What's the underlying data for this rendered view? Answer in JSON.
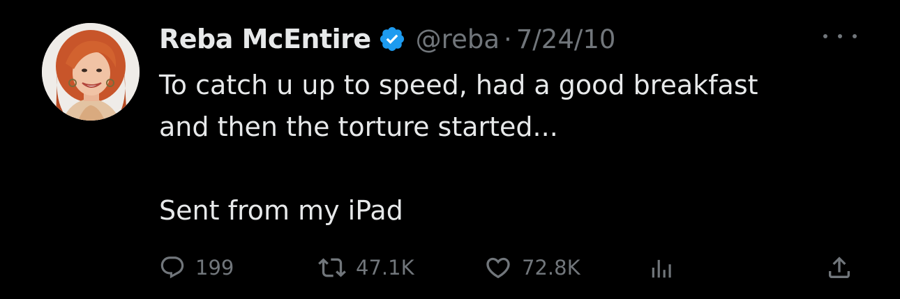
{
  "tweet": {
    "display_name": "Reba McEntire",
    "handle": "@reba",
    "separator": "·",
    "date": "7/24/10",
    "text_line1": "To catch u up to speed, had a good breakfast",
    "text_line2": "and then the torture started...",
    "text_line3": "Sent from my iPad",
    "verified_color": "#1d9bf0"
  },
  "actions": {
    "reply_count": "199",
    "retweet_count": "47.1K",
    "like_count": "72.8K"
  },
  "icons": {
    "more": "more-horizontal-icon",
    "reply": "reply-bubble-icon",
    "retweet": "retweet-arrows-icon",
    "like": "heart-icon",
    "views": "bar-chart-icon",
    "share": "share-upload-icon",
    "verified": "verified-badge-icon"
  }
}
